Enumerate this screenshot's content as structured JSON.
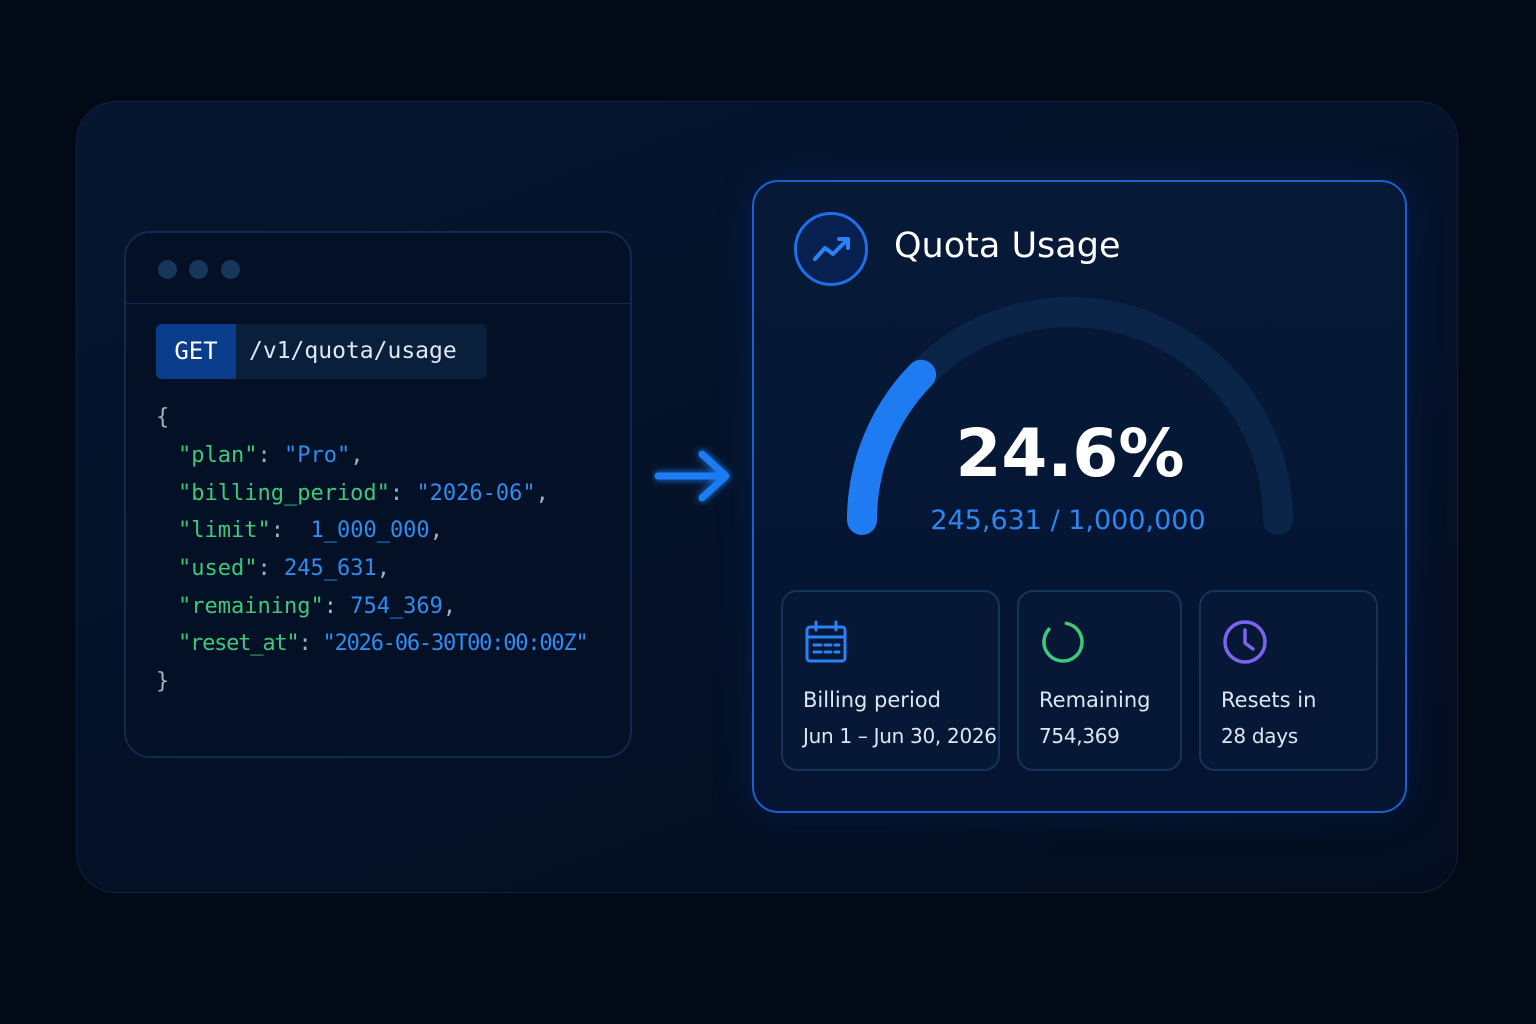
{
  "request": {
    "method": "GET",
    "path": "/v1/quota/usage"
  },
  "json_lines": [
    {
      "type": "brace",
      "text": "{"
    },
    {
      "type": "kv",
      "key": "\"plan\"",
      "sep": ": ",
      "value": "\"Pro\"",
      "end": ","
    },
    {
      "type": "kv",
      "key": "\"billing_period\"",
      "sep": ": ",
      "value": "\"2026-06\"",
      "end": ","
    },
    {
      "type": "kv",
      "key": "\"limit\"",
      "sep": ":  ",
      "value": "1_000_000",
      "end": ","
    },
    {
      "type": "kv",
      "key": "\"used\"",
      "sep": ": ",
      "value": "245_631",
      "end": ","
    },
    {
      "type": "kv",
      "key": "\"remaining\"",
      "sep": ": ",
      "value": "754_369",
      "end": ","
    },
    {
      "type": "kv",
      "key": "\"reset_at\"",
      "sep": ": ",
      "value": "\"2026-06-30T00:00:00Z\"",
      "end": ""
    },
    {
      "type": "brace",
      "text": "}"
    }
  ],
  "card": {
    "title": "Quota Usage",
    "icon": "trend-up-icon",
    "percent_label": "24.6%",
    "usage_fraction": 0.246,
    "ratio_label": "245,631 / 1,000,000"
  },
  "tiles": [
    {
      "icon": "calendar-icon",
      "label": "Billing period",
      "value": "Jun 1 – Jun 30, 2026"
    },
    {
      "icon": "progress-ring-icon",
      "label": "Remaining",
      "value": "754,369"
    },
    {
      "icon": "clock-icon",
      "label": "Resets in",
      "value": "28 days"
    }
  ],
  "colors": {
    "background": "#020a18",
    "accent": "#1f7bf2",
    "json_key": "#3ec87a",
    "json_value": "#2f8cf0",
    "remaining_ring": "#3ec87a",
    "clock": "#7b64f0"
  }
}
